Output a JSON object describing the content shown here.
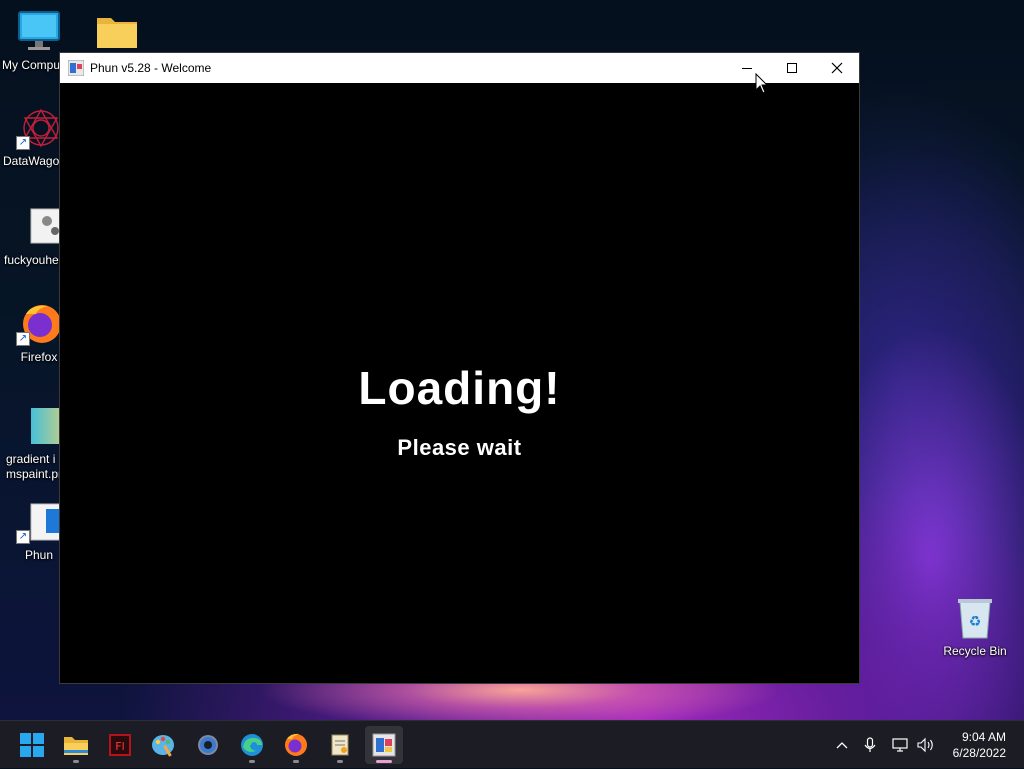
{
  "desktop": {
    "icons": [
      {
        "label": "My Compu"
      },
      {
        "label": ""
      },
      {
        "label": "DataWagon"
      },
      {
        "label": "fuckyouhe"
      },
      {
        "label": "Firefox"
      },
      {
        "label": "gradient i\nmspaint.pr"
      },
      {
        "label": "Phun"
      },
      {
        "label": "Recycle Bin"
      }
    ]
  },
  "window": {
    "title": "Phun v5.28 - Welcome",
    "loading_text": "Loading!",
    "wait_text": "Please wait",
    "controls": [
      "minimize",
      "maximize",
      "close"
    ]
  },
  "taskbar": {
    "apps": [
      "start-icon",
      "file-explorer-icon",
      "flash-icon",
      "paint-icon",
      "settings-icon",
      "edge-icon",
      "firefox-icon",
      "notepad-icon",
      "phun-icon"
    ],
    "active_app": "phun-icon",
    "clock": {
      "time": "9:04 AM",
      "date": "6/28/2022"
    }
  },
  "colors": {
    "taskbar_bg": "#1c1c24",
    "window_bg": "#000000",
    "accent": "#e8a0d8"
  }
}
